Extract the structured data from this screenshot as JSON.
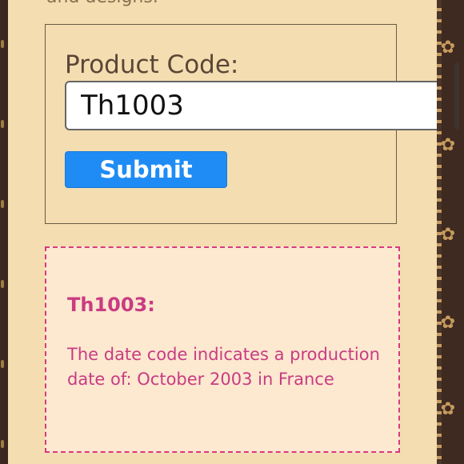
{
  "intro_fragment": "and designs.",
  "form": {
    "label": "Product Code:",
    "input_value": "Th1003",
    "submit_label": "Submit"
  },
  "result": {
    "title": "Th1003:",
    "body": "The date code indicates a production date of: October 2003 in France"
  },
  "colors": {
    "panel_bg": "#f4ddb0",
    "form_border": "#6b5a43",
    "button_blue": "#1f8cf5",
    "result_pink": "#c93c82",
    "result_bg": "#fde8d0",
    "pattern_brown": "#3f2a21",
    "pattern_gold": "#c69b5d"
  },
  "icons": {
    "decor": "monogram-flower-icon"
  }
}
